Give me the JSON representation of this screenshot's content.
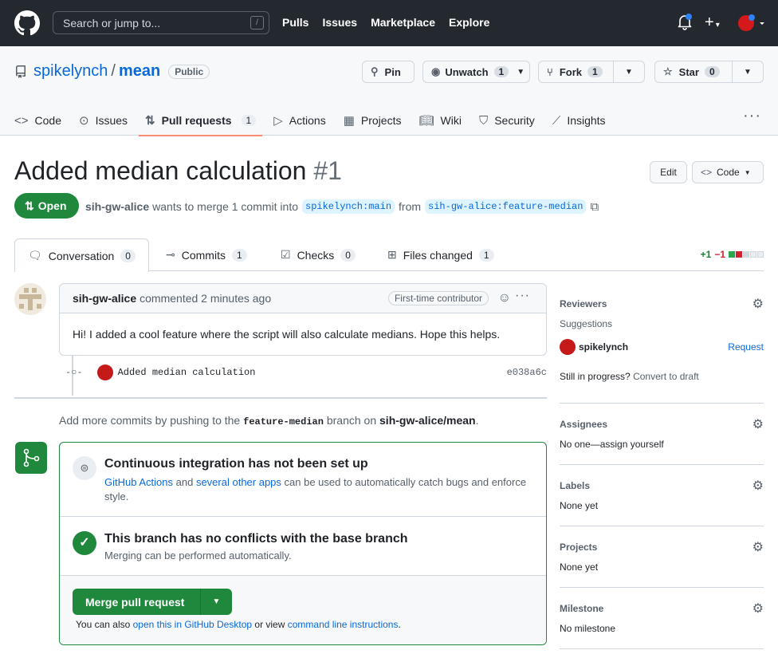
{
  "header": {
    "search_placeholder": "Search or jump to...",
    "search_key": "/",
    "nav": [
      "Pulls",
      "Issues",
      "Marketplace",
      "Explore"
    ]
  },
  "repo": {
    "owner": "spikelynch",
    "separator": "/",
    "name": "mean",
    "visibility": "Public",
    "pin": "Pin",
    "unwatch": "Unwatch",
    "unwatch_count": "1",
    "fork": "Fork",
    "fork_count": "1",
    "star": "Star",
    "star_count": "0"
  },
  "tabs": [
    {
      "label": "Code",
      "icon": "code-icon"
    },
    {
      "label": "Issues",
      "icon": "issue-icon"
    },
    {
      "label": "Pull requests",
      "icon": "pull-request-icon",
      "count": "1"
    },
    {
      "label": "Actions",
      "icon": "play-icon"
    },
    {
      "label": "Projects",
      "icon": "table-icon"
    },
    {
      "label": "Wiki",
      "icon": "book-icon"
    },
    {
      "label": "Security",
      "icon": "shield-icon"
    },
    {
      "label": "Insights",
      "icon": "graph-icon"
    }
  ],
  "pr": {
    "title": "Added median calculation",
    "number": "#1",
    "edit": "Edit",
    "code": "Code",
    "state": "Open",
    "author": "sih-gw-alice",
    "meta_text": "wants to merge 1 commit into",
    "base": "spikelynch:main",
    "from": "from",
    "head": "sih-gw-alice:feature-median"
  },
  "prtabs": {
    "conversation": "Conversation",
    "conversation_count": "0",
    "commits": "Commits",
    "commits_count": "1",
    "checks": "Checks",
    "checks_count": "0",
    "files": "Files changed",
    "files_count": "1",
    "additions": "+1",
    "deletions": "−1"
  },
  "comment": {
    "author": "sih-gw-alice",
    "action": "commented 2 minutes ago",
    "badge": "First-time contributor",
    "body": "Hi! I added a cool feature where the script will also calculate medians. Hope this helps."
  },
  "commit": {
    "message": "Added median calculation",
    "sha": "e038a6c"
  },
  "addmore": {
    "prefix": "Add more commits by pushing to the",
    "branch": "feature-median",
    "middle": "branch on",
    "repo": "sih-gw-alice/mean",
    "suffix": "."
  },
  "merge": {
    "ci_title": "Continuous integration has not been set up",
    "ci_link1": "GitHub Actions",
    "ci_and": "and",
    "ci_link2": "several other apps",
    "ci_rest": "can be used to automatically catch bugs and enforce style.",
    "conflict_title": "This branch has no conflicts with the base branch",
    "conflict_sub": "Merging can be performed automatically.",
    "button": "Merge pull request",
    "also": "You can also",
    "desktop_link": "open this in GitHub Desktop",
    "or_view": "or view",
    "cli_link": "command line instructions",
    "period": "."
  },
  "sidebar": {
    "reviewers": "Reviewers",
    "suggestions": "Suggestions",
    "suggested_user": "spikelynch",
    "request": "Request",
    "in_progress": "Still in progress?",
    "convert": "Convert to draft",
    "assignees": "Assignees",
    "assignees_value": "No one—assign yourself",
    "labels": "Labels",
    "labels_value": "None yet",
    "projects": "Projects",
    "projects_value": "None yet",
    "milestone": "Milestone",
    "milestone_value": "No milestone"
  },
  "colors": {
    "accent": "#0969da",
    "success": "#1f883d",
    "header": "#24292f",
    "tab_underline": "#fd8c73"
  }
}
